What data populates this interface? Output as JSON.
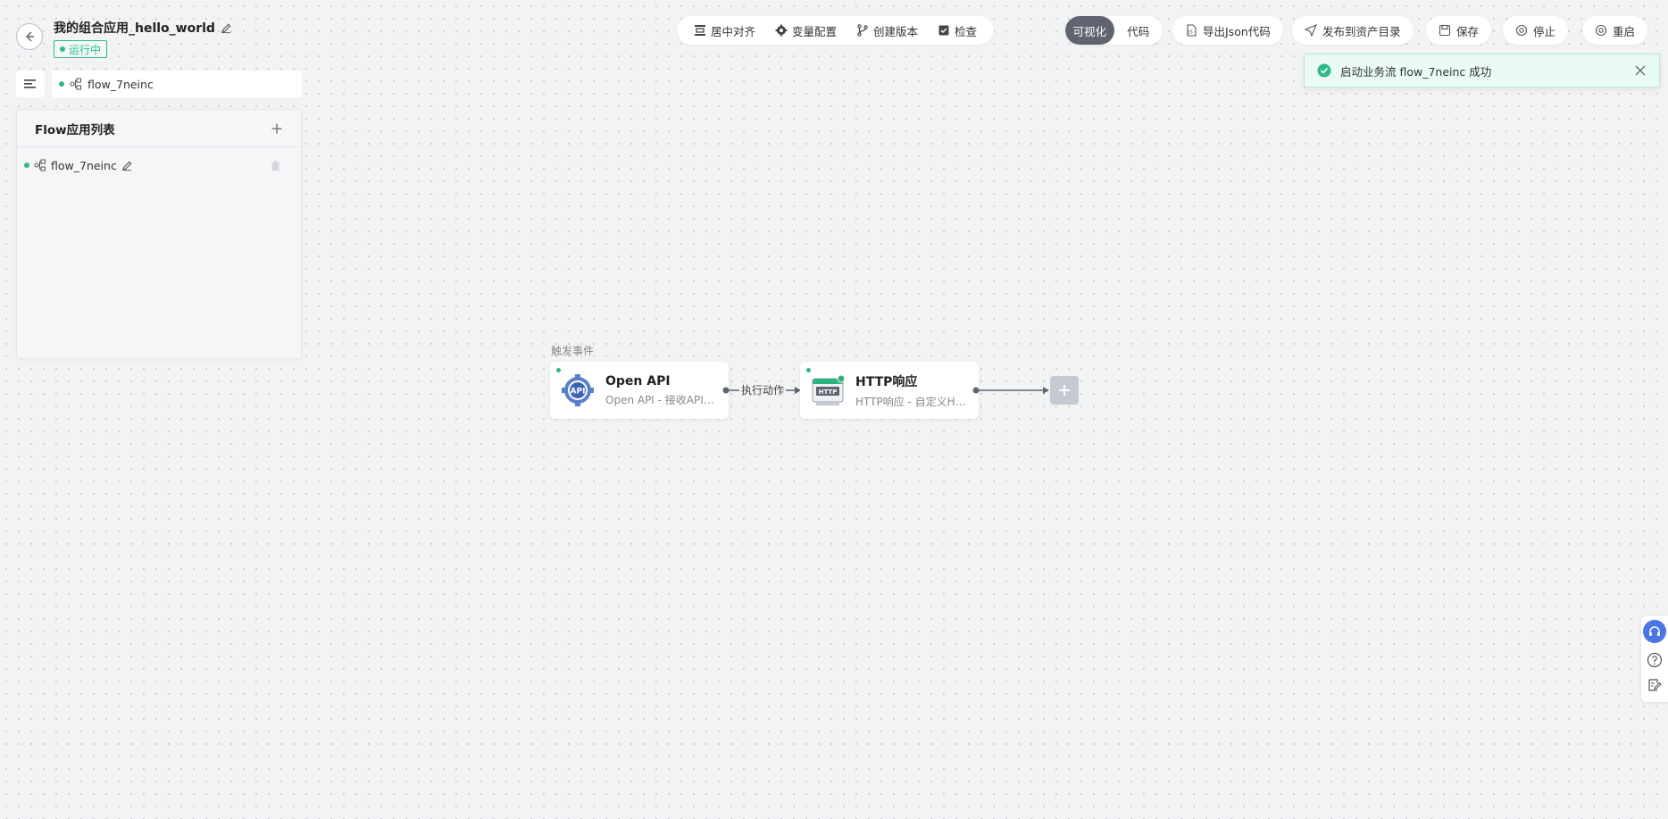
{
  "header": {
    "app_title": "我的组合应用_hello_world",
    "status": "运行中"
  },
  "toolbar": {
    "center": "居中对齐",
    "variables": "变量配置",
    "create_version": "创建版本",
    "check": "检查"
  },
  "mode": {
    "visual": "可视化",
    "code": "代码"
  },
  "actions": {
    "export_json": "导出Json代码",
    "publish": "发布到资产目录",
    "save": "保存",
    "stop": "停止",
    "restart": "重启"
  },
  "toast": {
    "message": "启动业务流 flow_7neinc 成功"
  },
  "left": {
    "active_flow": "flow_7neinc",
    "panel_title": "Flow应用列表",
    "items": [
      {
        "name": "flow_7neinc"
      }
    ]
  },
  "canvas": {
    "trigger_label": "触发事件",
    "edge_label": "执行动作",
    "nodes": [
      {
        "title": "Open API",
        "subtitle": "Open API - 接收API请求"
      },
      {
        "title": "HTTP响应",
        "subtitle": "HTTP响应 - 自定义HTTP响应"
      }
    ]
  },
  "colors": {
    "success": "#31b88c",
    "active_toggle": "#5f6470",
    "support": "#4b74e6"
  }
}
